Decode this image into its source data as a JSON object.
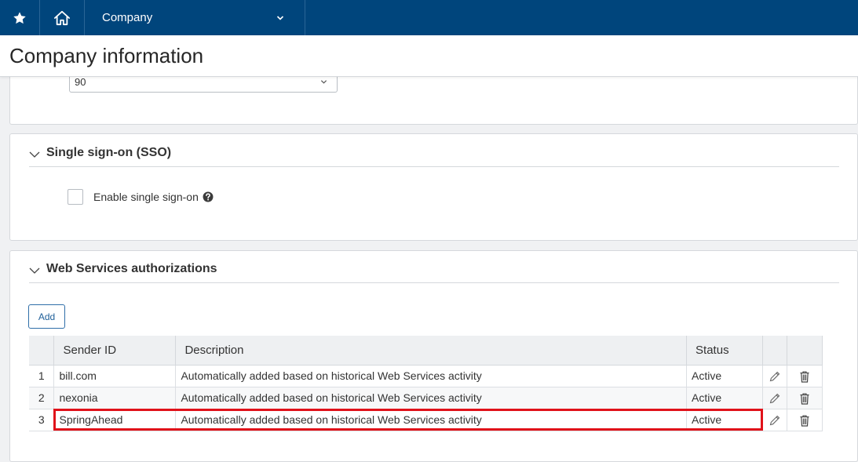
{
  "topbar": {
    "star_icon": "star-icon",
    "home_icon": "home-icon",
    "company_label": "Company"
  },
  "page": {
    "title": "Company information"
  },
  "retention": {
    "select_value": "90"
  },
  "sso": {
    "title": "Single sign-on (SSO)",
    "checkbox_label": "Enable single sign-on",
    "checked": false
  },
  "web_services": {
    "title": "Web Services authorizations",
    "add_label": "Add",
    "columns": {
      "sender_id": "Sender ID",
      "description": "Description",
      "status": "Status"
    },
    "rows": [
      {
        "num": "1",
        "sender_id": "bill.com",
        "description": "Automatically added based on historical Web Services activity",
        "status": "Active"
      },
      {
        "num": "2",
        "sender_id": "nexonia",
        "description": "Automatically added based on historical Web Services activity",
        "status": "Active"
      },
      {
        "num": "3",
        "sender_id": "SpringAhead",
        "description": "Automatically added based on historical Web Services activity",
        "status": "Active"
      }
    ],
    "highlighted_row": "3"
  },
  "colors": {
    "topbar": "#00457c",
    "highlight": "#e0121a",
    "accent": "#1f5f99"
  }
}
